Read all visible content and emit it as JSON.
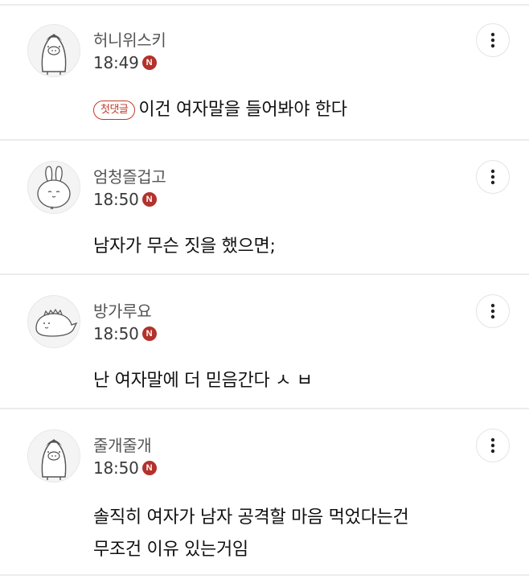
{
  "comments": [
    {
      "nickname": "허니위스키",
      "time": "18:49",
      "new_badge": "N",
      "first_badge": "첫댓글",
      "text": "이건 여자말을 들어봐야 한다",
      "avatar_icon": "penguin-pig-icon",
      "more_icon": "more-vertical-icon"
    },
    {
      "nickname": "엄청즐겁고",
      "time": "18:50",
      "new_badge": "N",
      "text": "남자가 무슨 짓을 했으면;",
      "avatar_icon": "rabbit-icon",
      "more_icon": "more-vertical-icon"
    },
    {
      "nickname": "방가루요",
      "time": "18:50",
      "new_badge": "N",
      "text": "난 여자말에 더 믿음간다 ㅅ ㅂ",
      "avatar_icon": "dinosaur-icon",
      "more_icon": "more-vertical-icon"
    },
    {
      "nickname": "줄개줄개",
      "time": "18:50",
      "new_badge": "N",
      "lines": [
        "솔직히 여자가 남자 공격할 마음 먹었다는건",
        "무조건 이유 있는거임"
      ],
      "avatar_icon": "penguin-pig-icon",
      "more_icon": "more-vertical-icon"
    }
  ],
  "colors": {
    "new_badge": "#b3322b",
    "first_badge": "#c0392b",
    "divider": "#ececec"
  }
}
